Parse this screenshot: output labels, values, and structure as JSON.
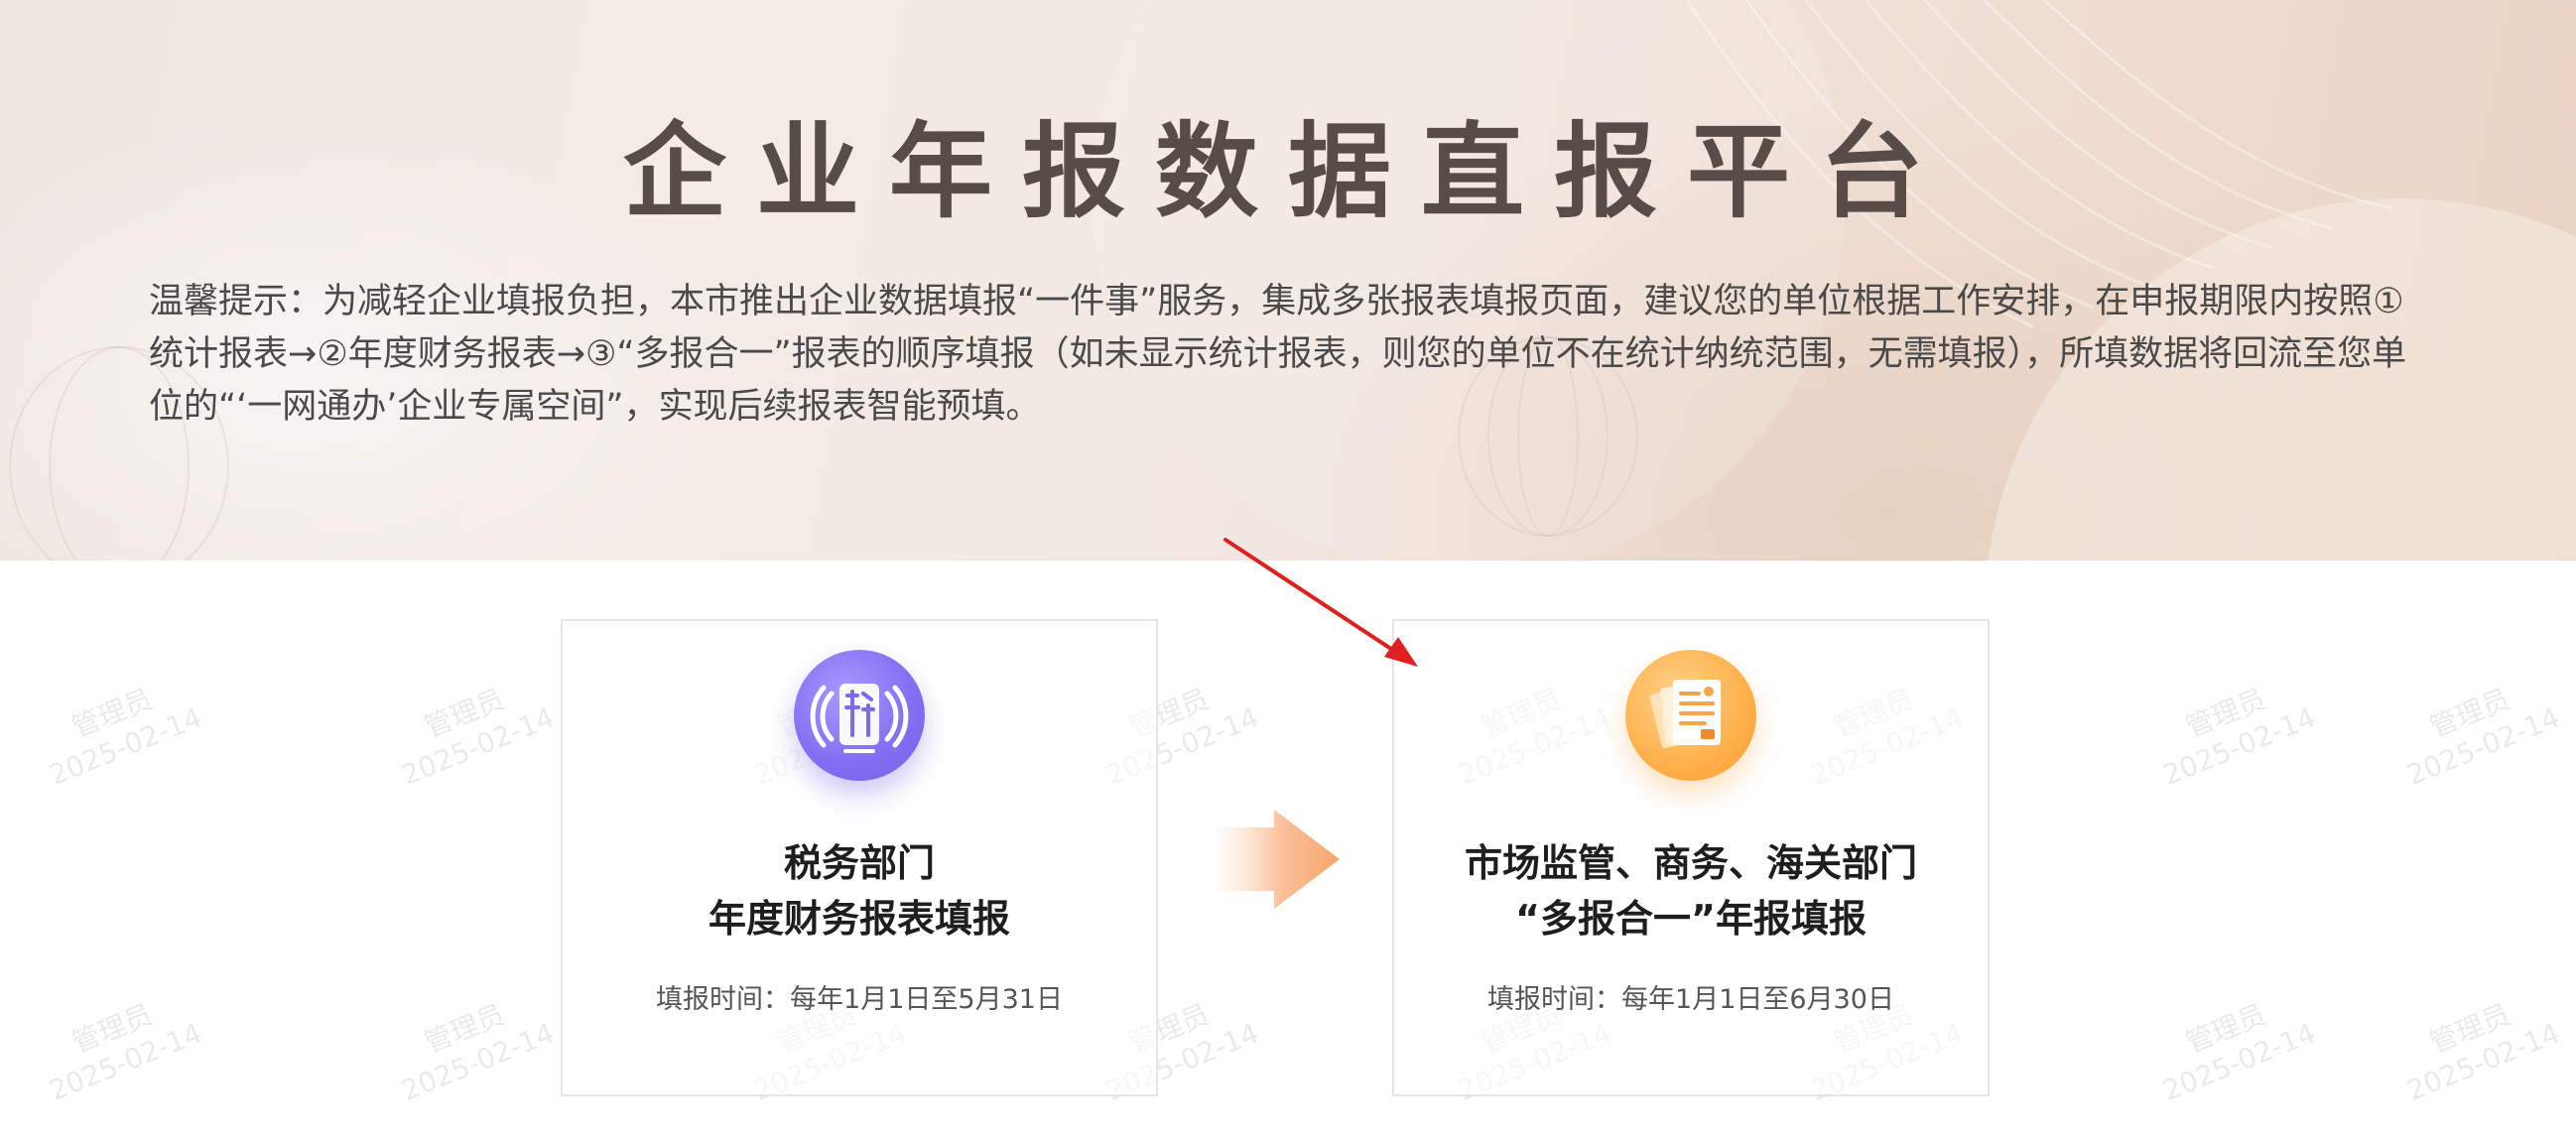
{
  "header": {
    "title": "企业年报数据直报平台",
    "notice": "温馨提示：为减轻企业填报负担，本市推出企业数据填报“一件事”服务，集成多张报表填报页面，建议您的单位根据工作安排，在申报期限内按照①统计报表→②年度财务报表→③“多报合一”报表的顺序填报（如未显示统计报表，则您的单位不在统计纳统范围，无需填报），所填数据将回流至您单位的“‘一网通办’企业专属空间”，实现后续报表智能预填。"
  },
  "cards": [
    {
      "icon": "tax-icon",
      "title_line1": "税务部门",
      "title_line2": "年度财务报表填报",
      "time": "填报时间：每年1月1日至5月31日"
    },
    {
      "icon": "document-icon",
      "title_line1": "市场监管、商务、海关部门",
      "title_line2": "“多报合一”年报填报",
      "time": "填报时间：每年1月1日至6月30日"
    }
  ],
  "watermark": {
    "user": "管理员",
    "date": "2025-02-14"
  },
  "colors": {
    "title": "#574c47",
    "tax_icon": "#8370f3",
    "doc_icon": "#ffb04a",
    "flow_arrow": "#f7a56a",
    "pointer": "#e02020"
  }
}
